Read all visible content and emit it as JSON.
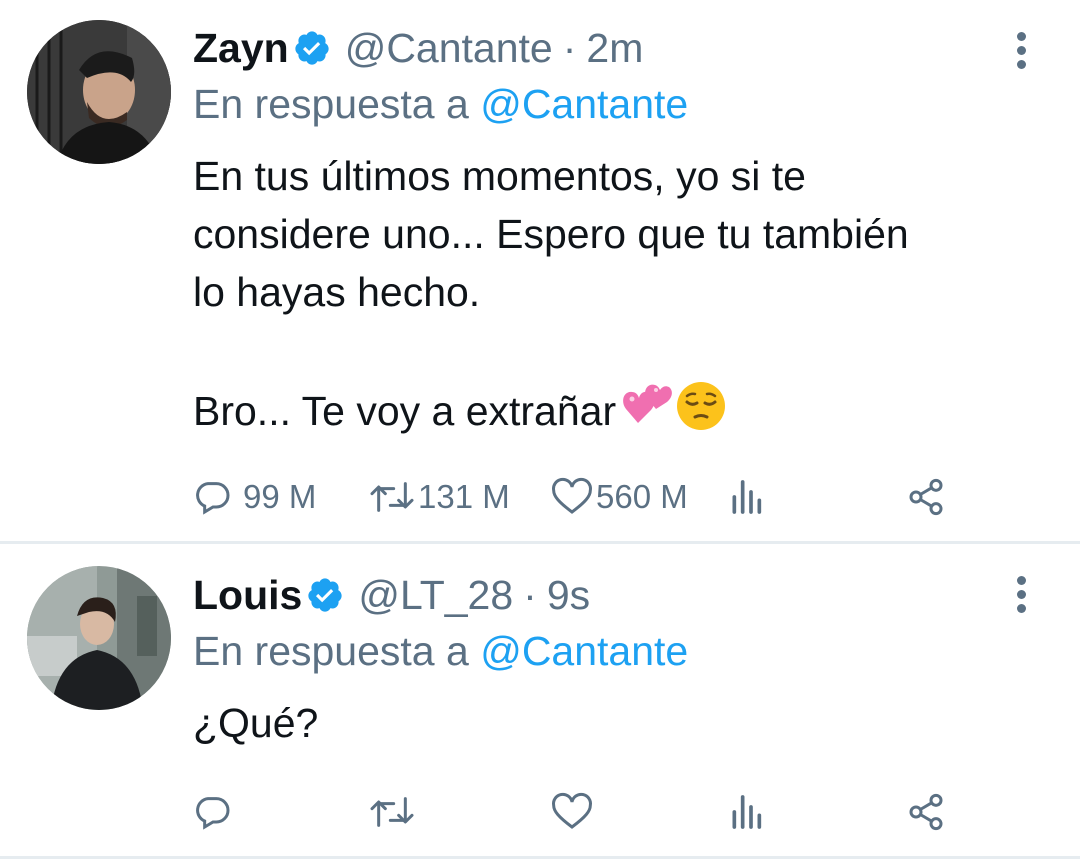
{
  "tweets": [
    {
      "name": "Zayn",
      "handle": "@Cantante",
      "separator": "·",
      "time": "2m",
      "reply_prefix": "En respuesta a",
      "reply_handle": "@Cantante",
      "body": "En tus últimos momentos, yo si te\nconsidere uno... Espero que tu también\nlo hayas hecho.\n\nBro... Te voy a extrañar",
      "body_emojis": [
        "two-hearts-emoji",
        "pensive-face-emoji"
      ],
      "replies": "99 M",
      "retweets": "131 M",
      "likes": "560 M"
    },
    {
      "name": "Louis",
      "handle": "@LT_28",
      "separator": "·",
      "time": "9s",
      "reply_prefix": "En respuesta a",
      "reply_handle": "@Cantante",
      "body": "¿Qué?",
      "replies": "",
      "retweets": "",
      "likes": ""
    }
  ],
  "colors": {
    "accent": "#1da1f2",
    "secondary_text": "#5b7083",
    "primary_text": "#0f1419",
    "divider": "#e6ecf0"
  }
}
